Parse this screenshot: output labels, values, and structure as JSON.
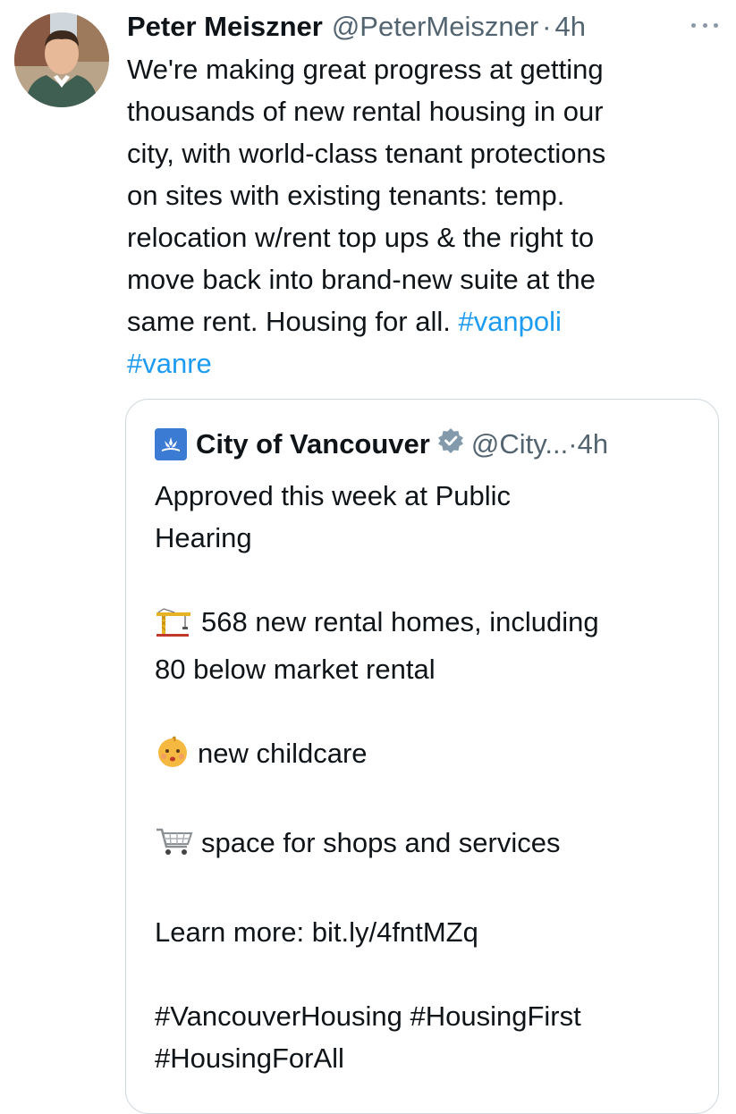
{
  "tweet": {
    "author_name": "Peter Meiszner",
    "author_handle": "@PeterMeiszner",
    "separator": "·",
    "time": "4h",
    "text_lines": [
      "We're making great progress at getting",
      "thousands of new rental housing in our",
      "city, with world-class tenant protections",
      "on sites with existing tenants: temp.",
      "relocation w/rent top ups & the right to",
      "move back into brand-new suite at the",
      "same rent. Housing for all. "
    ],
    "hashtags": [
      "#vanpoli",
      "#vanre"
    ],
    "more_icon": "ellipsis-icon",
    "avatar_icon": "profile-photo"
  },
  "quote": {
    "author_name": "City of Vancouver",
    "author_handle": "@City...",
    "separator": "·",
    "time": "4h",
    "verified_icon": "verified-badge-icon",
    "avatar_icon": "city-logo",
    "lines": {
      "l1": "Approved this week at Public",
      "l2": "Hearing",
      "l3": "568 new rental homes, including",
      "l4": "80 below market rental",
      "l5": "new childcare",
      "l6": "space for shops and services",
      "l7": "Learn more: bit.ly/4fntMZq",
      "l8": "#VancouverHousing #HousingFirst",
      "l9": "#HousingForAll"
    },
    "emoji": {
      "crane": "crane-emoji",
      "baby": "baby-emoji",
      "cart": "shopping-cart-emoji"
    }
  },
  "colors": {
    "link": "#1d9bf0",
    "text": "#0f1419",
    "muted": "#536471",
    "border": "#cfd9de"
  }
}
